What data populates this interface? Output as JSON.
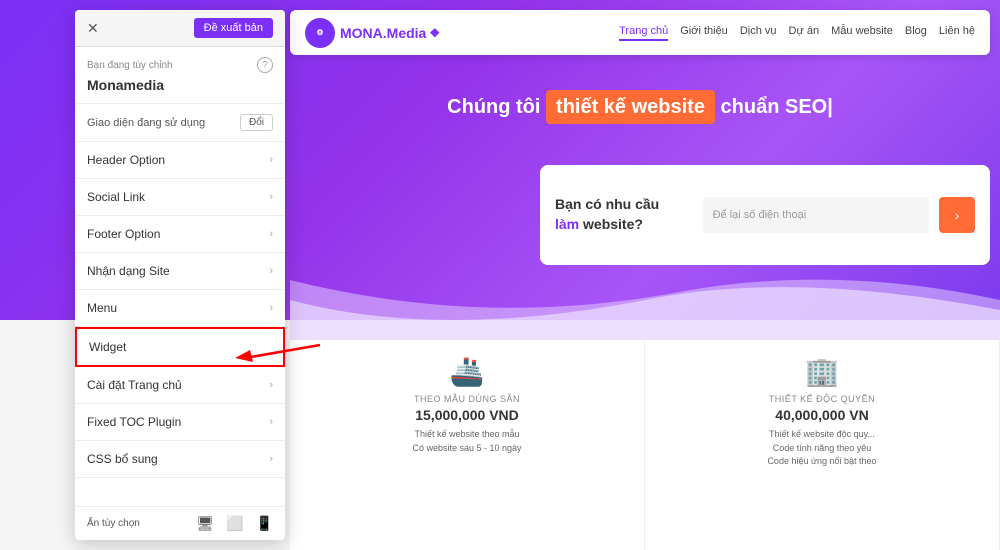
{
  "sidebar": {
    "close_label": "✕",
    "publish_btn": "Đề xuất bản",
    "customizing_label": "Bạn đang tùy chỉnh",
    "help_icon": "?",
    "site_name": "Monamedia",
    "theme_label": "Giao diện đang sử dụng",
    "theme_btn": "Đổi",
    "menu_items": [
      {
        "id": "header-option",
        "label": "Header Option",
        "has_arrow": true
      },
      {
        "id": "social-link",
        "label": "Social Link",
        "has_arrow": true
      },
      {
        "id": "footer-option",
        "label": "Footer Option",
        "has_arrow": true
      },
      {
        "id": "nhan-dang-site",
        "label": "Nhận dạng Site",
        "has_arrow": true
      },
      {
        "id": "menu",
        "label": "Menu",
        "has_arrow": true
      },
      {
        "id": "widget",
        "label": "Widget",
        "has_arrow": false,
        "highlighted": true
      },
      {
        "id": "cai-dat-trang-chu",
        "label": "Cài đặt Trang chủ",
        "has_arrow": true
      },
      {
        "id": "fixed-toc",
        "label": "Fixed TOC Plugin",
        "has_arrow": true
      },
      {
        "id": "css-bo-sung",
        "label": "CSS bổ sung",
        "has_arrow": true
      }
    ],
    "footer_label": "Ẩn tùy chọn",
    "footer_icons": [
      "desktop",
      "tablet",
      "mobile"
    ]
  },
  "navbar": {
    "logo_text": "MONA.Media",
    "logo_dots": "❖",
    "nav_links": [
      {
        "label": "Trang chủ",
        "active": true
      },
      {
        "label": "Giới thiệu",
        "active": false
      },
      {
        "label": "Dịch vụ",
        "active": false
      },
      {
        "label": "Dự án",
        "active": false
      },
      {
        "label": "Mẫu website",
        "active": false
      },
      {
        "label": "Blog",
        "active": false
      },
      {
        "label": "Liên hệ",
        "active": false
      }
    ]
  },
  "hero": {
    "text_before": "Chúng tôi",
    "highlight_text": "thiết kế website",
    "text_after": "chuẩn SEO|"
  },
  "contact_box": {
    "title_line1": "Bạn có nhu cầu",
    "title_line2": "làm",
    "title_line3": "website?",
    "input_placeholder": "Để lại số điện thoại"
  },
  "cards": [
    {
      "icon": "🚢",
      "subtitle": "THEO MẪU DÙNG SẴN",
      "price": "15,000,000 VND",
      "desc_lines": [
        "Thiết kế website theo mẫu",
        "Có website sau 5 - 10 ngày"
      ]
    },
    {
      "icon": "🏢",
      "subtitle": "THIẾT KẾ ĐỘC QUYỀN",
      "price": "40,000,000 VN",
      "desc_lines": [
        "Thiết kế website độc quy...",
        "Code tính năng theo yêu",
        "Code hiệu ứng nổi bật theo"
      ]
    }
  ],
  "colors": {
    "accent_purple": "#7b2ff7",
    "accent_orange": "#ff6b35",
    "widget_border": "red"
  }
}
